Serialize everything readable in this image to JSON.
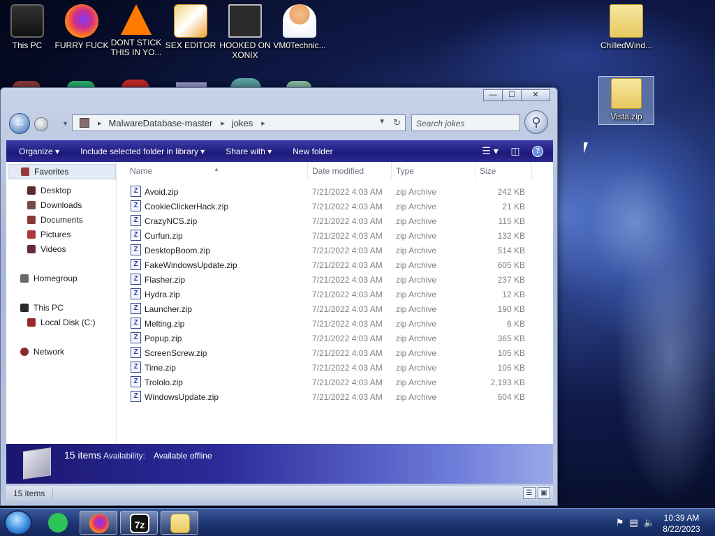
{
  "desktop": {
    "icons": [
      {
        "label": "This PC",
        "icon": "this-pc-icon"
      },
      {
        "label": "FURRY FUCK",
        "icon": "firefox-icon"
      },
      {
        "label": "DONT STICK THIS IN YO...",
        "icon": "vlc-icon"
      },
      {
        "label": "SEX EDITOR",
        "icon": "hxd-icon"
      },
      {
        "label": "HOOKED ON XONIX",
        "icon": "xonix-icon"
      },
      {
        "label": "VM0Technic...",
        "icon": "person-icon"
      },
      {
        "label": "ChilledWind...",
        "icon": "zip-folder-icon"
      },
      {
        "label": "Vista.zip",
        "icon": "zip-folder-icon"
      }
    ]
  },
  "window": {
    "caption_buttons": {
      "minimize": "—",
      "maximize": "☐",
      "close": "✕"
    },
    "address": {
      "root_icon": "folder-icon",
      "crumbs": [
        "MalwareDatabase-master",
        "jokes"
      ]
    },
    "search": {
      "placeholder": "Search jokes"
    },
    "toolbar": {
      "organize": "Organize ▾",
      "include": "Include selected folder in library ▾",
      "share": "Share with ▾",
      "new_folder": "New folder",
      "help": "?"
    },
    "nav_pane": {
      "favorites": "Favorites",
      "favorites_items": [
        "Desktop",
        "Downloads",
        "Documents",
        "Pictures",
        "Videos"
      ],
      "homegroup": "Homegroup",
      "this_pc": "This PC",
      "this_pc_items": [
        "Local Disk (C:)"
      ],
      "network": "Network"
    },
    "columns": {
      "name": "Name",
      "date": "Date modified",
      "type": "Type",
      "size": "Size"
    },
    "files": [
      {
        "name": "Avoid.zip",
        "date": "7/21/2022 4:03 AM",
        "type": "zip Archive",
        "size": "242 KB"
      },
      {
        "name": "CookieClickerHack.zip",
        "date": "7/21/2022 4:03 AM",
        "type": "zip Archive",
        "size": "21 KB"
      },
      {
        "name": "CrazyNCS.zip",
        "date": "7/21/2022 4:03 AM",
        "type": "zip Archive",
        "size": "115 KB"
      },
      {
        "name": "Curfun.zip",
        "date": "7/21/2022 4:03 AM",
        "type": "zip Archive",
        "size": "132 KB"
      },
      {
        "name": "DesktopBoom.zip",
        "date": "7/21/2022 4:03 AM",
        "type": "zip Archive",
        "size": "514 KB"
      },
      {
        "name": "FakeWindowsUpdate.zip",
        "date": "7/21/2022 4:03 AM",
        "type": "zip Archive",
        "size": "605 KB"
      },
      {
        "name": "Flasher.zip",
        "date": "7/21/2022 4:03 AM",
        "type": "zip Archive",
        "size": "237 KB"
      },
      {
        "name": "Hydra.zip",
        "date": "7/21/2022 4:03 AM",
        "type": "zip Archive",
        "size": "12 KB"
      },
      {
        "name": "Launcher.zip",
        "date": "7/21/2022 4:03 AM",
        "type": "zip Archive",
        "size": "190 KB"
      },
      {
        "name": "Melting.zip",
        "date": "7/21/2022 4:03 AM",
        "type": "zip Archive",
        "size": "6 KB"
      },
      {
        "name": "Popup.zip",
        "date": "7/21/2022 4:03 AM",
        "type": "zip Archive",
        "size": "365 KB"
      },
      {
        "name": "ScreenScrew.zip",
        "date": "7/21/2022 4:03 AM",
        "type": "zip Archive",
        "size": "105 KB"
      },
      {
        "name": "Time.zip",
        "date": "7/21/2022 4:03 AM",
        "type": "zip Archive",
        "size": "105 KB"
      },
      {
        "name": "Trololo.zip",
        "date": "7/21/2022 4:03 AM",
        "type": "zip Archive",
        "size": "2,193 KB"
      },
      {
        "name": "WindowsUpdate.zip",
        "date": "7/21/2022 4:03 AM",
        "type": "zip Archive",
        "size": "604 KB"
      }
    ],
    "details": {
      "count": "15 items",
      "availability_label": "Availability:",
      "availability_value": "Available offline"
    },
    "status": {
      "items": "15 items"
    }
  },
  "taskbar": {
    "apps": [
      {
        "name": "start-orb"
      },
      {
        "name": "taskbar-app-green",
        "glyph": ""
      },
      {
        "name": "taskbar-app-firefox",
        "glyph": ""
      },
      {
        "name": "taskbar-app-7zip",
        "glyph": "7z"
      },
      {
        "name": "taskbar-app-explorer",
        "glyph": ""
      }
    ],
    "clock": {
      "time": "10:39 AM",
      "date": "8/22/2023"
    }
  },
  "colors": {
    "toolbar": "#1e1a7a",
    "details_start": "#1a1670",
    "taskbar": "#1c3470"
  }
}
